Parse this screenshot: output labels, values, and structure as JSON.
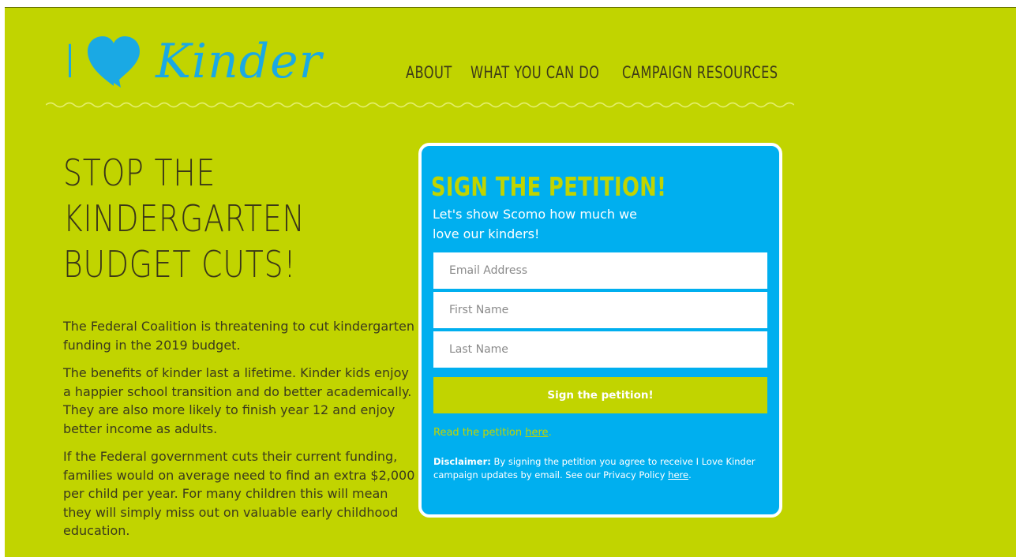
{
  "brand": {
    "logo_prefix": "I",
    "logo_word": "Kinder",
    "heart_color": "#1aa9e4"
  },
  "colors": {
    "background": "#c1d400",
    "accent_blue": "#00afef",
    "text_dark": "#3a3618"
  },
  "nav": {
    "items": [
      {
        "label": "ABOUT"
      },
      {
        "label": "WHAT YOU CAN DO"
      },
      {
        "label": "CAMPAIGN RESOURCES"
      }
    ]
  },
  "hero": {
    "headline_line1": "STOP THE",
    "headline_line2": "KINDERGARTEN",
    "headline_line3": "BUDGET CUTS!",
    "paragraphs": [
      "The Federal Coalition is threatening to cut kindergarten funding in the 2019 budget.",
      "The benefits of kinder last a lifetime. Kinder kids enjoy a happier school transition and do better academically. They are also more likely to finish year 12 and enjoy better income as adults.",
      "If the Federal government cuts their current funding, families would on average need to find an extra $2,000 per child per year.  For many children this will mean they will simply miss out on valuable early childhood education."
    ]
  },
  "petition": {
    "title": "SIGN THE PETITION!",
    "subtitle": "Let's show Scomo how much we love our kinders!",
    "email_placeholder": "Email Address",
    "first_name_placeholder": "First Name",
    "last_name_placeholder": "Last Name",
    "submit_label": "Sign the petition!",
    "read_prefix": "Read the petition ",
    "read_link": "here",
    "read_suffix": ".",
    "disclaimer_label": "Disclaimer:",
    "disclaimer_text": " By signing the petition you agree to receive I Love Kinder campaign updates by email. See our Privacy Policy ",
    "disclaimer_link": "here",
    "disclaimer_suffix": "."
  }
}
